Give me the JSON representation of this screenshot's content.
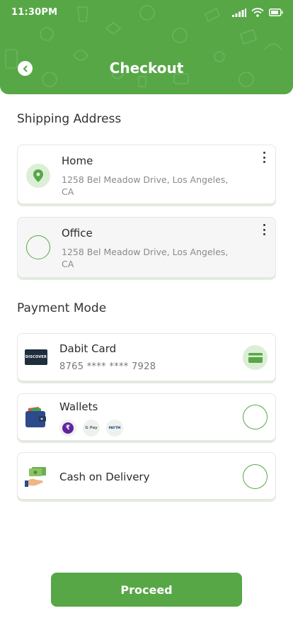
{
  "status_bar": {
    "time": "11:30PM"
  },
  "header": {
    "title": "Checkout"
  },
  "shipping": {
    "title": "Shipping Address",
    "addresses": [
      {
        "name": "Home",
        "line": "1258 Bel Meadow Drive, Los Angeles, CA",
        "selected": true
      },
      {
        "name": "Office",
        "line": "1258 Bel Meadow Drive, Los Angeles, CA",
        "selected": false
      }
    ]
  },
  "payment": {
    "title": "Payment Mode",
    "methods": [
      {
        "name": "Dabit Card",
        "detail": "8765 **** **** 7928",
        "logo_text": "DISCOVER",
        "selected": true
      },
      {
        "name": "Wallets",
        "chips": [
          "₹",
          "G Pay",
          "PAYTM"
        ],
        "selected": false
      },
      {
        "name": "Cash on Delivery",
        "selected": false
      }
    ]
  },
  "proceed_label": "Proceed",
  "colors": {
    "primary": "#57a747",
    "light_green": "#dcefd6"
  }
}
